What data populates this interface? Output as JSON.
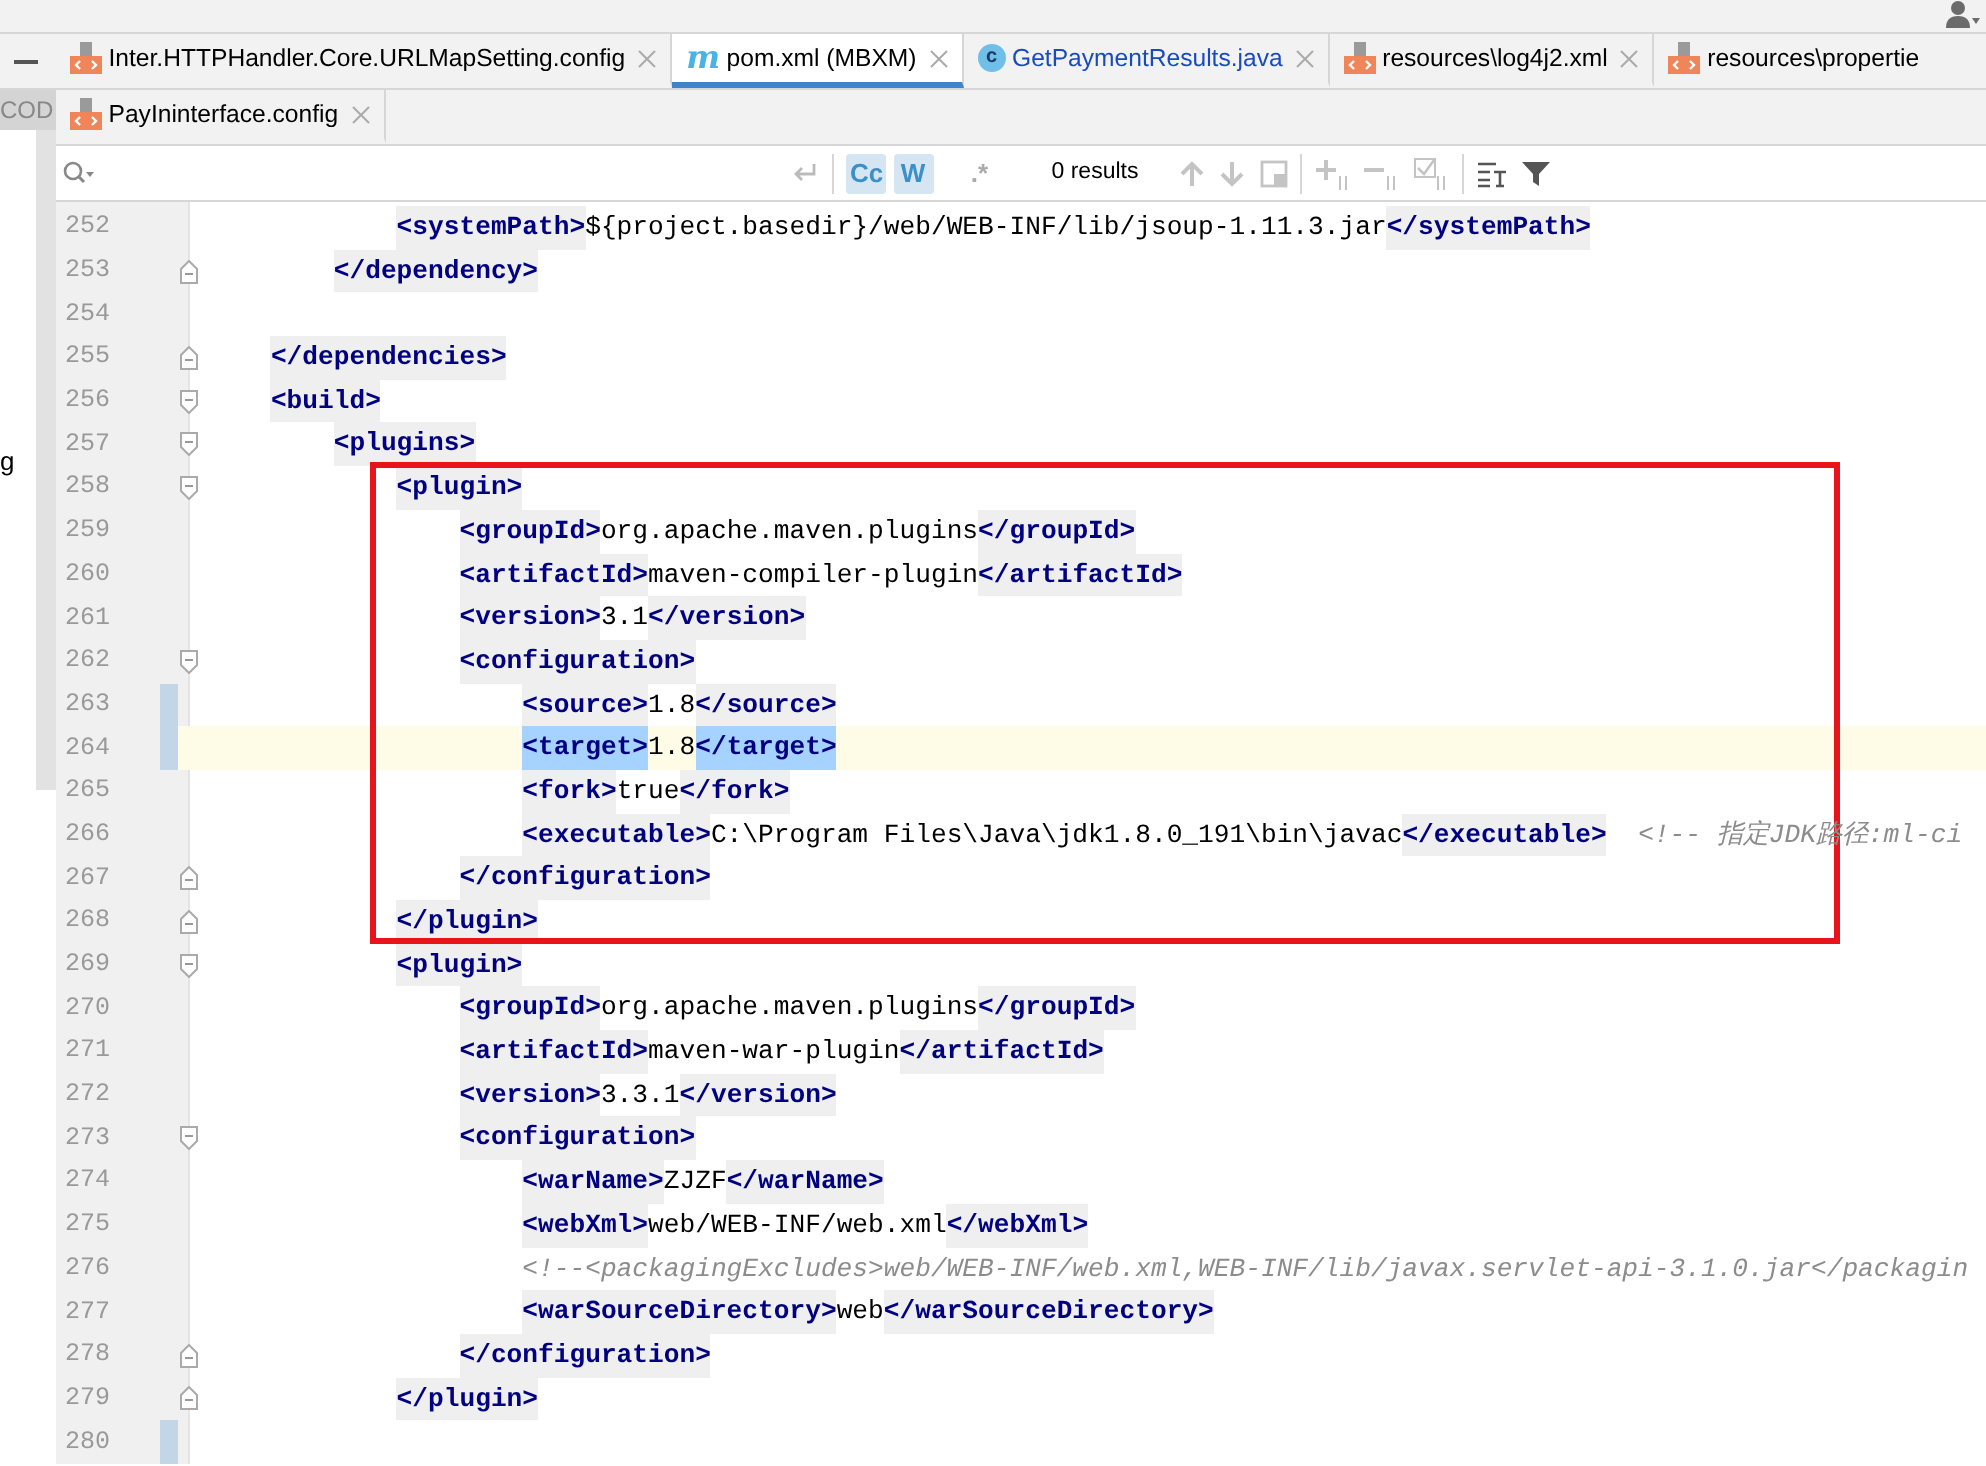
{
  "side_strip": {
    "label": "COD",
    "cut_text": "g"
  },
  "tabs_row_1": [
    {
      "kind": "xml",
      "label": "Inter.HTTPHandler.Core.URLMapSetting.config",
      "selected": false
    },
    {
      "kind": "maven",
      "icon_text": "m",
      "label": "pom.xml (MBXM)",
      "selected": true
    },
    {
      "kind": "class",
      "icon_text": "c",
      "label": "GetPaymentResults.java",
      "selected": false
    },
    {
      "kind": "xml",
      "label": "resources\\log4j2.xml",
      "selected": false
    },
    {
      "kind": "xml",
      "label": "resources\\propertie",
      "selected": false,
      "cut": true
    }
  ],
  "tabs_row_2": [
    {
      "kind": "xml",
      "label": "PayIninterface.config",
      "selected": false
    }
  ],
  "find_bar": {
    "toggles": [
      {
        "label": "Cc",
        "selected": true
      },
      {
        "label": "W",
        "selected": true
      },
      {
        "label": ".*",
        "selected": false
      }
    ],
    "results": "0 results"
  },
  "editor": {
    "lines_before": [
      {
        "number": "252",
        "tokens": [
          {
            "kind": "tag",
            "text": "            <systemPath>"
          },
          {
            "kind": "value",
            "text": "${project.basedir}/web/WEB-INF/lib/jsoup-1.11.3.jar"
          },
          {
            "kind": "tag",
            "text": "</systemPath>"
          }
        ]
      },
      {
        "number": "253",
        "fold_end": true,
        "tokens": [
          {
            "kind": "tag",
            "text": "        </dependency>"
          }
        ]
      },
      {
        "number": "254"
      },
      {
        "number": "255",
        "fold_end": true,
        "tokens": [
          {
            "kind": "tag",
            "text": "    </dependencies>"
          }
        ]
      },
      {
        "number": "256",
        "fold_start": true,
        "tokens": [
          {
            "kind": "tag",
            "text": "    <build>"
          }
        ]
      },
      {
        "number": "257",
        "fold_start": true,
        "tokens": [
          {
            "kind": "tag",
            "text": "        <plugins>"
          }
        ]
      }
    ],
    "highlight_box": {
      "lines": [
        {
          "number": "258",
          "fold_start": true,
          "tokens": [
            {
              "kind": "tag",
              "text": "            <plugin>"
            }
          ]
        },
        {
          "number": "259",
          "tokens": [
            {
              "kind": "tag",
              "text": "                <groupId>"
            },
            {
              "kind": "value",
              "text": "org.apache.maven.plugins"
            },
            {
              "kind": "tag",
              "text": "</groupId>"
            }
          ]
        },
        {
          "number": "260",
          "tokens": [
            {
              "kind": "tag",
              "text": "                <artifactId>"
            },
            {
              "kind": "value",
              "text": "maven-compiler-plugin"
            },
            {
              "kind": "tag",
              "text": "</artifactId>"
            }
          ]
        },
        {
          "number": "261",
          "tokens": [
            {
              "kind": "tag",
              "text": "                <version>"
            },
            {
              "kind": "value",
              "text": "3.1"
            },
            {
              "kind": "tag",
              "text": "</version>"
            }
          ]
        },
        {
          "number": "262",
          "fold_start": true,
          "tokens": [
            {
              "kind": "tag",
              "text": "                <configuration>"
            }
          ]
        },
        {
          "number": "263",
          "changed": true,
          "tokens": [
            {
              "kind": "tag",
              "text": "                    <source>"
            },
            {
              "kind": "value",
              "text": "1.8"
            },
            {
              "kind": "tag",
              "text": "</source>"
            }
          ]
        },
        {
          "number": "264",
          "changed": true,
          "current": true,
          "tokens": [
            {
              "kind": "selected_tag",
              "text": "                    <target>"
            },
            {
              "kind": "value",
              "text": "1.8"
            },
            {
              "kind": "caret"
            },
            {
              "kind": "selected_tag",
              "text": "</target>"
            }
          ]
        },
        {
          "number": "265",
          "tokens": [
            {
              "kind": "tag",
              "text": "                    <fork>"
            },
            {
              "kind": "value",
              "text": "true"
            },
            {
              "kind": "tag",
              "text": "</fork>"
            }
          ]
        },
        {
          "number": "266",
          "tokens": [
            {
              "kind": "tag",
              "text": "                    <executable>"
            },
            {
              "kind": "value",
              "text": "C:\\Program Files\\Java\\jdk1.8.0_191\\bin\\javac"
            },
            {
              "kind": "tag",
              "text": "</executable>"
            },
            {
              "kind": "comment",
              "text": "  <!-- 指定JDK路径:ml-ci"
            }
          ]
        },
        {
          "number": "267",
          "fold_end": true,
          "tokens": [
            {
              "kind": "tag",
              "text": "                </configuration>"
            }
          ]
        },
        {
          "number": "268",
          "fold_end": true,
          "tokens": [
            {
              "kind": "tag",
              "text": "            </plugin>"
            }
          ]
        }
      ]
    },
    "lines_after": [
      {
        "number": "269",
        "fold_start": true,
        "tokens": [
          {
            "kind": "tag",
            "text": "            <plugin>"
          }
        ]
      },
      {
        "number": "270",
        "tokens": [
          {
            "kind": "tag",
            "text": "                <groupId>"
          },
          {
            "kind": "value",
            "text": "org.apache.maven.plugins"
          },
          {
            "kind": "tag",
            "text": "</groupId>"
          }
        ]
      },
      {
        "number": "271",
        "tokens": [
          {
            "kind": "tag",
            "text": "                <artifactId>"
          },
          {
            "kind": "value",
            "text": "maven-war-plugin"
          },
          {
            "kind": "tag",
            "text": "</artifactId>"
          }
        ]
      },
      {
        "number": "272",
        "tokens": [
          {
            "kind": "tag",
            "text": "                <version>"
          },
          {
            "kind": "value",
            "text": "3.3.1"
          },
          {
            "kind": "tag",
            "text": "</version>"
          }
        ]
      },
      {
        "number": "273",
        "fold_start": true,
        "tokens": [
          {
            "kind": "tag",
            "text": "                <configuration>"
          }
        ]
      },
      {
        "number": "274",
        "tokens": [
          {
            "kind": "tag",
            "text": "                    <warName>"
          },
          {
            "kind": "value",
            "text": "ZJZF"
          },
          {
            "kind": "tag",
            "text": "</warName>"
          }
        ]
      },
      {
        "number": "275",
        "tokens": [
          {
            "kind": "tag",
            "text": "                    <webXml>"
          },
          {
            "kind": "value",
            "text": "web/WEB-INF/web.xml"
          },
          {
            "kind": "tag",
            "text": "</webXml>"
          }
        ]
      },
      {
        "number": "276",
        "tokens": [
          {
            "kind": "comment",
            "text": "                    <!--<packagingExcludes>web/WEB-INF/web.xml,WEB-INF/lib/javax.servlet-api-3.1.0.jar</packagin"
          }
        ]
      },
      {
        "number": "277",
        "tokens": [
          {
            "kind": "tag",
            "text": "                    <warSourceDirectory>"
          },
          {
            "kind": "value",
            "text": "web"
          },
          {
            "kind": "tag",
            "text": "</warSourceDirectory>"
          }
        ]
      },
      {
        "number": "278",
        "fold_end": true,
        "tokens": [
          {
            "kind": "tag",
            "text": "                </configuration>"
          }
        ]
      },
      {
        "number": "279",
        "fold_end": true,
        "tokens": [
          {
            "kind": "tag",
            "text": "            </plugin>"
          }
        ]
      },
      {
        "number": "280",
        "changed": true
      }
    ]
  }
}
